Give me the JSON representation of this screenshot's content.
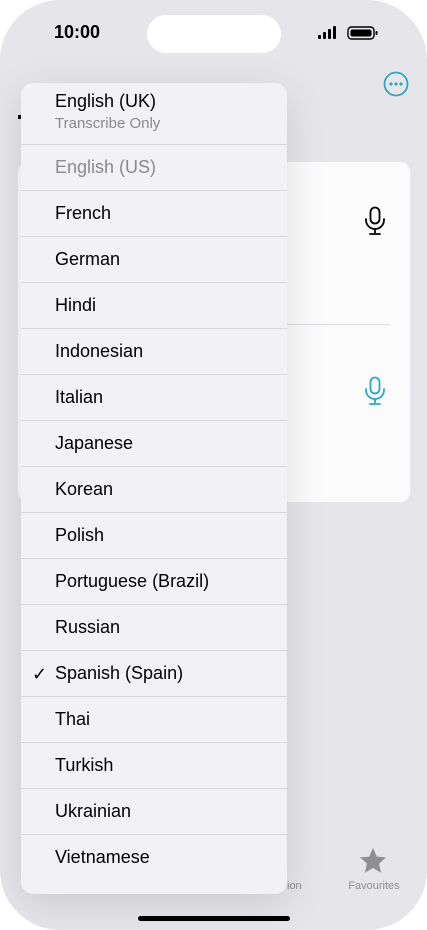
{
  "status_bar": {
    "time": "10:00"
  },
  "tab_bar": {
    "partial_label": "ion",
    "favourites_label": "Favourites"
  },
  "menu": {
    "items": [
      {
        "label": "English (UK)",
        "subtitle": "Transcribe Only",
        "disabled": false,
        "checked": false
      },
      {
        "label": "English (US)",
        "disabled": true,
        "checked": false
      },
      {
        "label": "French",
        "disabled": false,
        "checked": false
      },
      {
        "label": "German",
        "disabled": false,
        "checked": false
      },
      {
        "label": "Hindi",
        "disabled": false,
        "checked": false
      },
      {
        "label": "Indonesian",
        "disabled": false,
        "checked": false
      },
      {
        "label": "Italian",
        "disabled": false,
        "checked": false
      },
      {
        "label": "Japanese",
        "disabled": false,
        "checked": false
      },
      {
        "label": "Korean",
        "disabled": false,
        "checked": false
      },
      {
        "label": "Polish",
        "disabled": false,
        "checked": false
      },
      {
        "label": "Portuguese (Brazil)",
        "disabled": false,
        "checked": false
      },
      {
        "label": "Russian",
        "disabled": false,
        "checked": false
      },
      {
        "label": "Spanish (Spain)",
        "disabled": false,
        "checked": true
      },
      {
        "label": "Thai",
        "disabled": false,
        "checked": false
      },
      {
        "label": "Turkish",
        "disabled": false,
        "checked": false
      },
      {
        "label": "Ukrainian",
        "disabled": false,
        "checked": false
      },
      {
        "label": "Vietnamese",
        "disabled": false,
        "checked": false
      }
    ],
    "check_glyph": "✓"
  },
  "colors": {
    "accent": "#2aa7c4",
    "text": "#000000",
    "secondary": "#8a8a8e"
  },
  "icons": {
    "more": "ellipsis-circle-icon",
    "mic": "microphone-icon",
    "favourites": "star-icon"
  }
}
